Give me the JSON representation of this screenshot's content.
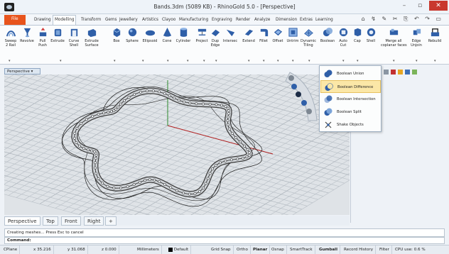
{
  "window": {
    "title": "Bands.3dm (5089 KB) - RhinoGold 5.0 - [Perspective]",
    "minimize": "–",
    "maximize": "▫",
    "close": "✕"
  },
  "tabs": [
    {
      "label": "File"
    },
    {
      "label": "Drawing"
    },
    {
      "label": "Modelling"
    },
    {
      "label": "Transform"
    },
    {
      "label": "Gems"
    },
    {
      "label": "Jewellery"
    },
    {
      "label": "Artistics"
    },
    {
      "label": "Clayoo"
    },
    {
      "label": "Manufacturing"
    },
    {
      "label": "Engraving"
    },
    {
      "label": "Render"
    },
    {
      "label": "Analyze"
    },
    {
      "label": "Dimension"
    },
    {
      "label": "Extras"
    },
    {
      "label": "Learning"
    }
  ],
  "quick_access": "⌂ ↯ ✎ ✂ ⎘ ↶ ↷ ▭",
  "tools": [
    {
      "label": "Sweep\n2 Rail"
    },
    {
      "label": "Revolve"
    },
    {
      "label": "Pull\nPush"
    },
    {
      "label": "Extrude"
    },
    {
      "label": "Curve\nShell"
    },
    {
      "label": "Extrude\nSurface"
    },
    {
      "label": "Box"
    },
    {
      "label": "Sphere"
    },
    {
      "label": "Ellipsoid"
    },
    {
      "label": "Cone"
    },
    {
      "label": "Cylinder"
    },
    {
      "label": "Project"
    },
    {
      "label": "Dup\nEdge"
    },
    {
      "label": "Intersec"
    },
    {
      "label": "Extend"
    },
    {
      "label": "Fillet"
    },
    {
      "label": "Offset"
    },
    {
      "label": "Untrim"
    },
    {
      "label": "Dynamic\nTiling"
    },
    {
      "label": "Boolean"
    },
    {
      "label": "Auto\nCut"
    },
    {
      "label": "Cap"
    },
    {
      "label": "Shell"
    },
    {
      "label": "Merge all\ncoplanar faces"
    },
    {
      "label": "Edge\nUnjoin"
    },
    {
      "label": "Rebuild"
    }
  ],
  "viewport": {
    "name": "Perspective",
    "dropdown": "▾"
  },
  "boolean_menu": [
    {
      "label": "Boolean Union",
      "highlighted": false
    },
    {
      "label": "Boolean Difference",
      "highlighted": true
    },
    {
      "label": "Boolean Intersection",
      "highlighted": false
    },
    {
      "label": "Boolean Split",
      "highlighted": false
    },
    {
      "label": "Shake Objects",
      "highlighted": false
    }
  ],
  "view_tabs": [
    {
      "label": "Perspective"
    },
    {
      "label": "Top"
    },
    {
      "label": "Front"
    },
    {
      "label": "Right"
    },
    {
      "label": "+"
    }
  ],
  "command": {
    "history": "Creating meshes... Press Esc to cancel",
    "prompt": "Command:"
  },
  "status": {
    "cplane": "CPlane",
    "x": "x 35.216",
    "y": "y 31.068",
    "z": "z 0.000",
    "units": "Millimeters",
    "layer": "Default",
    "grid_snap": "Grid Snap",
    "ortho": "Ortho",
    "planar": "Planar",
    "osnap": "Osnap",
    "smarttrack": "SmartTrack",
    "gumball": "Gumball",
    "record_history": "Record History",
    "filter": "Filter",
    "cpu": "CPU use: 0.6 %"
  },
  "colors": {
    "file_tab": "#e8541d",
    "close_button": "#c9382e",
    "highlight": "#fbe7a7",
    "x_axis": "#b01a1a",
    "y_axis": "#2c8a2c"
  }
}
